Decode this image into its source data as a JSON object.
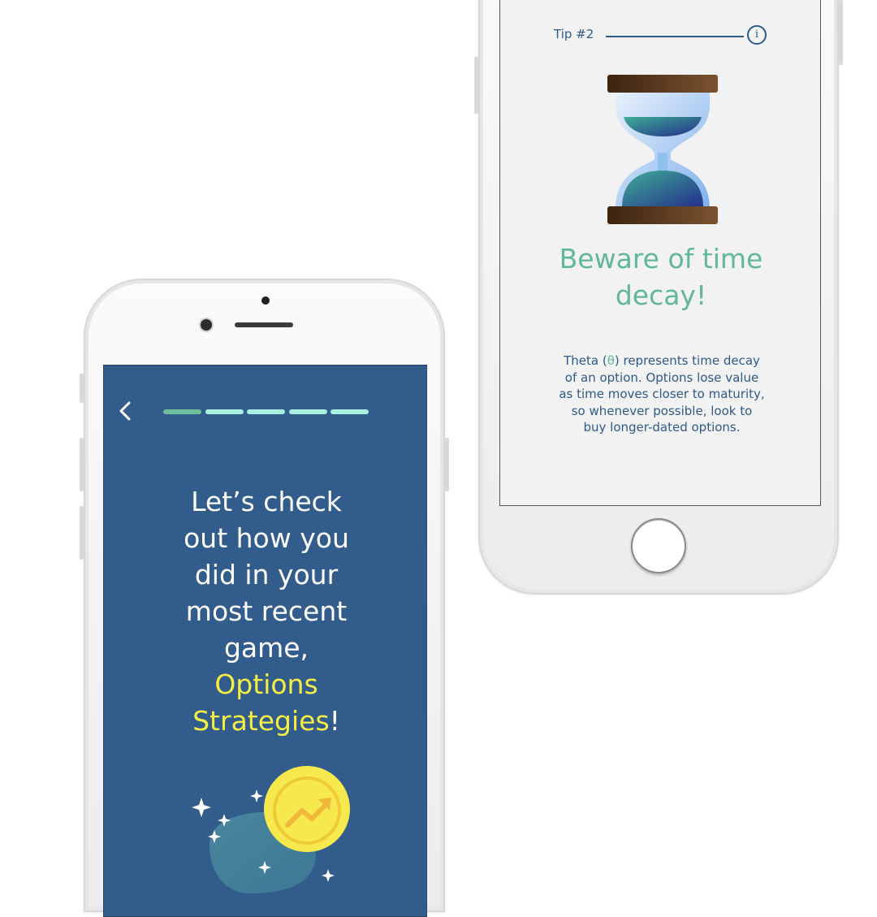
{
  "right_screen": {
    "tip_label": "Tip #2",
    "info_glyph": "i",
    "title": "Beware of time decay!",
    "body_lines": [
      [
        "Theta (",
        "θ",
        ") represents time decay"
      ],
      "of an option. Options lose value",
      "as time moves closer to maturity,",
      "so whenever possible, look to",
      "buy longer-dated options."
    ],
    "illustration": "hourglass-icon"
  },
  "left_screen": {
    "back_icon": "chevron-left-icon",
    "progress": {
      "total": 5,
      "completed": 1
    },
    "headline_lines": [
      "Let’s check",
      "out how you",
      "did in your",
      "most recent",
      "game,"
    ],
    "headline_highlight_1": "Options",
    "headline_highlight_2": "Strategies",
    "headline_end": "!",
    "illustration": "coin-trend-icon"
  },
  "colors": {
    "brand_blue": "#315c8c",
    "text_navy": "#2e5a8a",
    "accent_green": "#62b896",
    "highlight_yellow": "#f5ef44",
    "progress_done": "#6fbf9a",
    "progress_todo": "#a8f0df",
    "coin": "#f7e84e",
    "screen_light": "#f2f2f2"
  }
}
